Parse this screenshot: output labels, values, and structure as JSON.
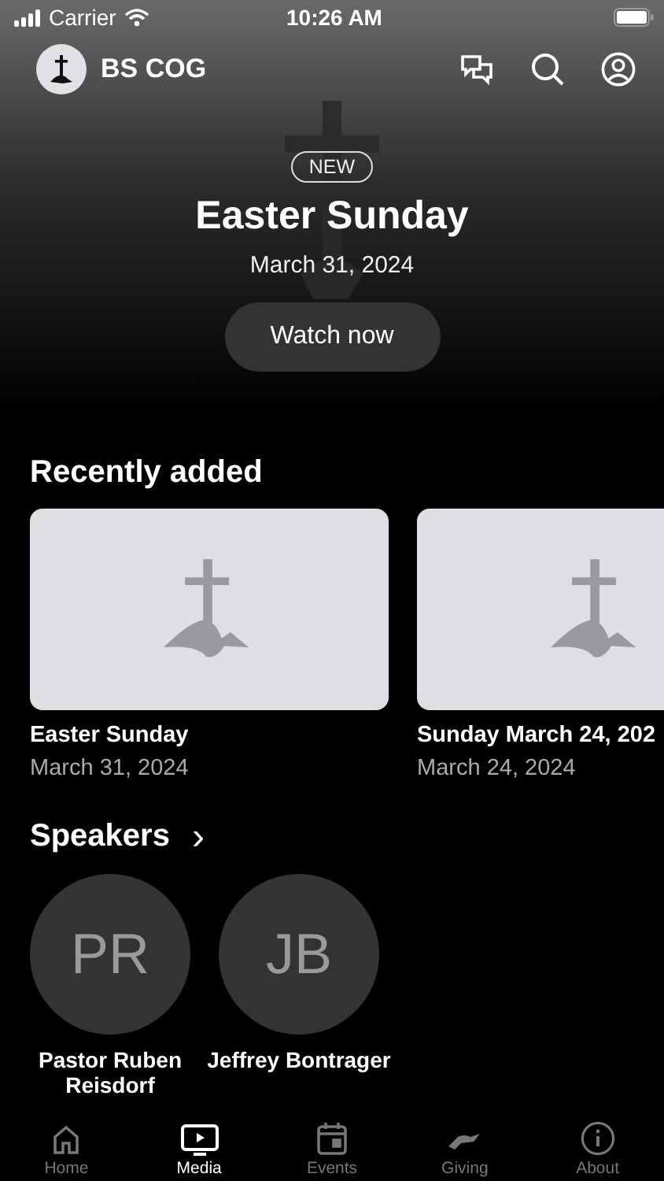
{
  "status_bar": {
    "carrier": "Carrier",
    "time": "10:26 AM"
  },
  "header": {
    "title": "BS COG"
  },
  "hero": {
    "badge": "NEW",
    "title": "Easter Sunday",
    "date": "March 31, 2024",
    "button": "Watch now"
  },
  "recently_added": {
    "title": "Recently added",
    "items": [
      {
        "title": "Easter Sunday",
        "date": "March 31, 2024"
      },
      {
        "title": "Sunday March 24, 202",
        "date": "March 24, 2024"
      }
    ]
  },
  "speakers": {
    "title": "Speakers",
    "more": "›",
    "items": [
      {
        "initials": "PR",
        "name": "Pastor Ruben Reisdorf"
      },
      {
        "initials": "JB",
        "name": "Jeffrey Bontrager"
      }
    ]
  },
  "tabs": [
    {
      "label": "Home",
      "kind": "home",
      "selected": false
    },
    {
      "label": "Media",
      "kind": "media",
      "selected": true
    },
    {
      "label": "Events",
      "kind": "events",
      "selected": false
    },
    {
      "label": "Giving",
      "kind": "giving",
      "selected": false
    },
    {
      "label": "About",
      "kind": "about",
      "selected": false
    }
  ]
}
